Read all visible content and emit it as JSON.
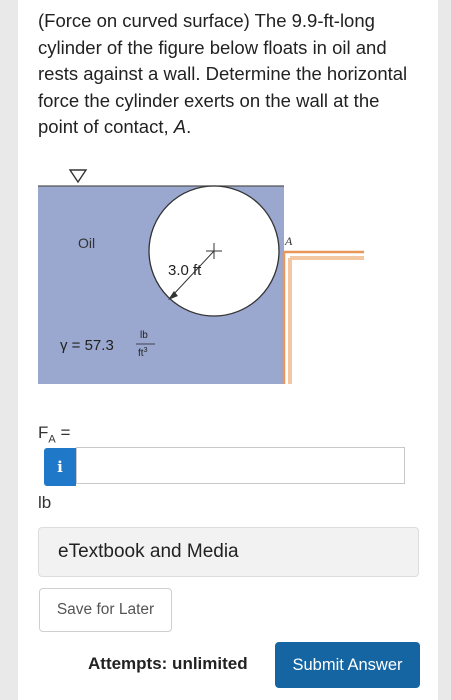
{
  "question": {
    "text_before_var": "(Force on curved surface) The 9.9-ft-long cylinder of the figure below floats in oil and rests against a wall. Determine the horizontal force the cylinder exerts on the wall at the point of contact, ",
    "point_var": "A",
    "text_after_var": "."
  },
  "figure": {
    "fluid_label": "Oil",
    "radius_label": "3.0 ft",
    "point_label": "A",
    "gamma_label": "γ = 57.3",
    "gamma_unit_num": "lb",
    "gamma_unit_den": "ft",
    "gamma_unit_exp": "3",
    "colors": {
      "oil": "#9aa7ce",
      "wall": "#f0a76d",
      "cylinder": "#ffffff"
    },
    "icons": [
      "free-surface-triangle-icon",
      "cylinder-center-cross-icon"
    ]
  },
  "answer": {
    "variable": "F",
    "subscript": "A",
    "equals": "=",
    "info_icon": "i",
    "value": "",
    "unit": "lb"
  },
  "links": {
    "etextbook": "eTextbook and Media"
  },
  "buttons": {
    "save_later": "Save for Later",
    "submit": "Submit Answer"
  },
  "attempts": "Attempts: unlimited",
  "colors": {
    "primary": "#1565a3",
    "info": "#1f78c8"
  }
}
